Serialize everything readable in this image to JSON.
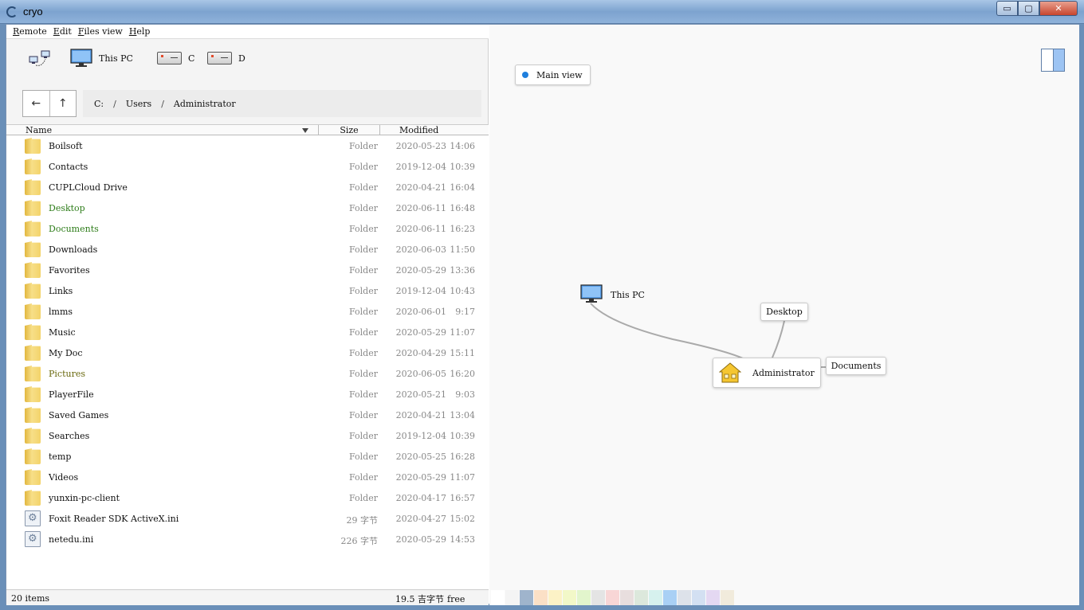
{
  "window": {
    "title": "cryo",
    "min": "▭",
    "max": "▢",
    "close": "✕"
  },
  "menu": [
    "Remote",
    "Edit",
    "Files view",
    "Help"
  ],
  "places": {
    "this_pc": "This PC",
    "drive_c": "C",
    "drive_d": "D"
  },
  "nav": {
    "back": "←",
    "up": "↑"
  },
  "path": [
    "C:",
    "Users",
    "Administrator"
  ],
  "path_sep": "/",
  "columns": {
    "name": "Name",
    "size": "Size",
    "modified": "Modified"
  },
  "files": [
    {
      "name": "Boilsoft",
      "type": "folder",
      "size": "Folder",
      "date": "2020-05-23",
      "time": "14:06",
      "color": "#111111"
    },
    {
      "name": "Contacts",
      "type": "folder",
      "size": "Folder",
      "date": "2019-12-04",
      "time": "10:39",
      "color": "#111111"
    },
    {
      "name": "CUPLCloud Drive",
      "type": "folder",
      "size": "Folder",
      "date": "2020-04-21",
      "time": "16:04",
      "color": "#111111"
    },
    {
      "name": "Desktop",
      "type": "folder",
      "size": "Folder",
      "date": "2020-06-11",
      "time": "16:48",
      "color": "#2e7d1a"
    },
    {
      "name": "Documents",
      "type": "folder",
      "size": "Folder",
      "date": "2020-06-11",
      "time": "16:23",
      "color": "#2e7d1a"
    },
    {
      "name": "Downloads",
      "type": "folder",
      "size": "Folder",
      "date": "2020-06-03",
      "time": "11:50",
      "color": "#111111"
    },
    {
      "name": "Favorites",
      "type": "folder",
      "size": "Folder",
      "date": "2020-05-29",
      "time": "13:36",
      "color": "#111111"
    },
    {
      "name": "Links",
      "type": "folder",
      "size": "Folder",
      "date": "2019-12-04",
      "time": "10:43",
      "color": "#111111"
    },
    {
      "name": "lmms",
      "type": "folder",
      "size": "Folder",
      "date": "2020-06-01",
      "time": "9:17",
      "color": "#111111"
    },
    {
      "name": "Music",
      "type": "folder",
      "size": "Folder",
      "date": "2020-05-29",
      "time": "11:07",
      "color": "#111111"
    },
    {
      "name": "My Doc",
      "type": "folder",
      "size": "Folder",
      "date": "2020-04-29",
      "time": "15:11",
      "color": "#111111"
    },
    {
      "name": "Pictures",
      "type": "folder",
      "size": "Folder",
      "date": "2020-06-05",
      "time": "16:20",
      "color": "#6b6a10"
    },
    {
      "name": "PlayerFile",
      "type": "folder",
      "size": "Folder",
      "date": "2020-05-21",
      "time": "9:03",
      "color": "#111111"
    },
    {
      "name": "Saved Games",
      "type": "folder",
      "size": "Folder",
      "date": "2020-04-21",
      "time": "13:04",
      "color": "#111111"
    },
    {
      "name": "Searches",
      "type": "folder",
      "size": "Folder",
      "date": "2019-12-04",
      "time": "10:39",
      "color": "#111111"
    },
    {
      "name": "temp",
      "type": "folder",
      "size": "Folder",
      "date": "2020-05-25",
      "time": "16:28",
      "color": "#111111"
    },
    {
      "name": "Videos",
      "type": "folder",
      "size": "Folder",
      "date": "2020-05-29",
      "time": "11:07",
      "color": "#111111"
    },
    {
      "name": "yunxin-pc-client",
      "type": "folder",
      "size": "Folder",
      "date": "2020-04-17",
      "time": "16:57",
      "color": "#111111"
    },
    {
      "name": "Foxit Reader SDK ActiveX.ini",
      "type": "file",
      "size": "29 字节",
      "date": "2020-04-27",
      "time": "15:02",
      "color": "#111111"
    },
    {
      "name": "netedu.ini",
      "type": "file",
      "size": "226 字节",
      "date": "2020-05-29",
      "time": "14:53",
      "color": "#111111"
    }
  ],
  "status": {
    "items": "20 items",
    "free_amount": "19.5 吉字节",
    "free_label": "free"
  },
  "view": {
    "chip_label": "Main view",
    "accent": "#1f7fdd"
  },
  "graph": {
    "this_pc": "This PC",
    "desktop": "Desktop",
    "administrator": "Administrator",
    "documents": "Documents"
  },
  "swatches": [
    "#ffffff",
    "#f4f4f4",
    "#9fb4cc",
    "#fbe0c6",
    "#fcf2c6",
    "#f2f8c8",
    "#e2f5cc",
    "#e4e4e4",
    "#f8d6d6",
    "#e8dede",
    "#dce8dc",
    "#d6f1ee",
    "#a9d0f5",
    "#dde2ea",
    "#d3e0f2",
    "#e4d8f2",
    "#f1ebdc"
  ]
}
